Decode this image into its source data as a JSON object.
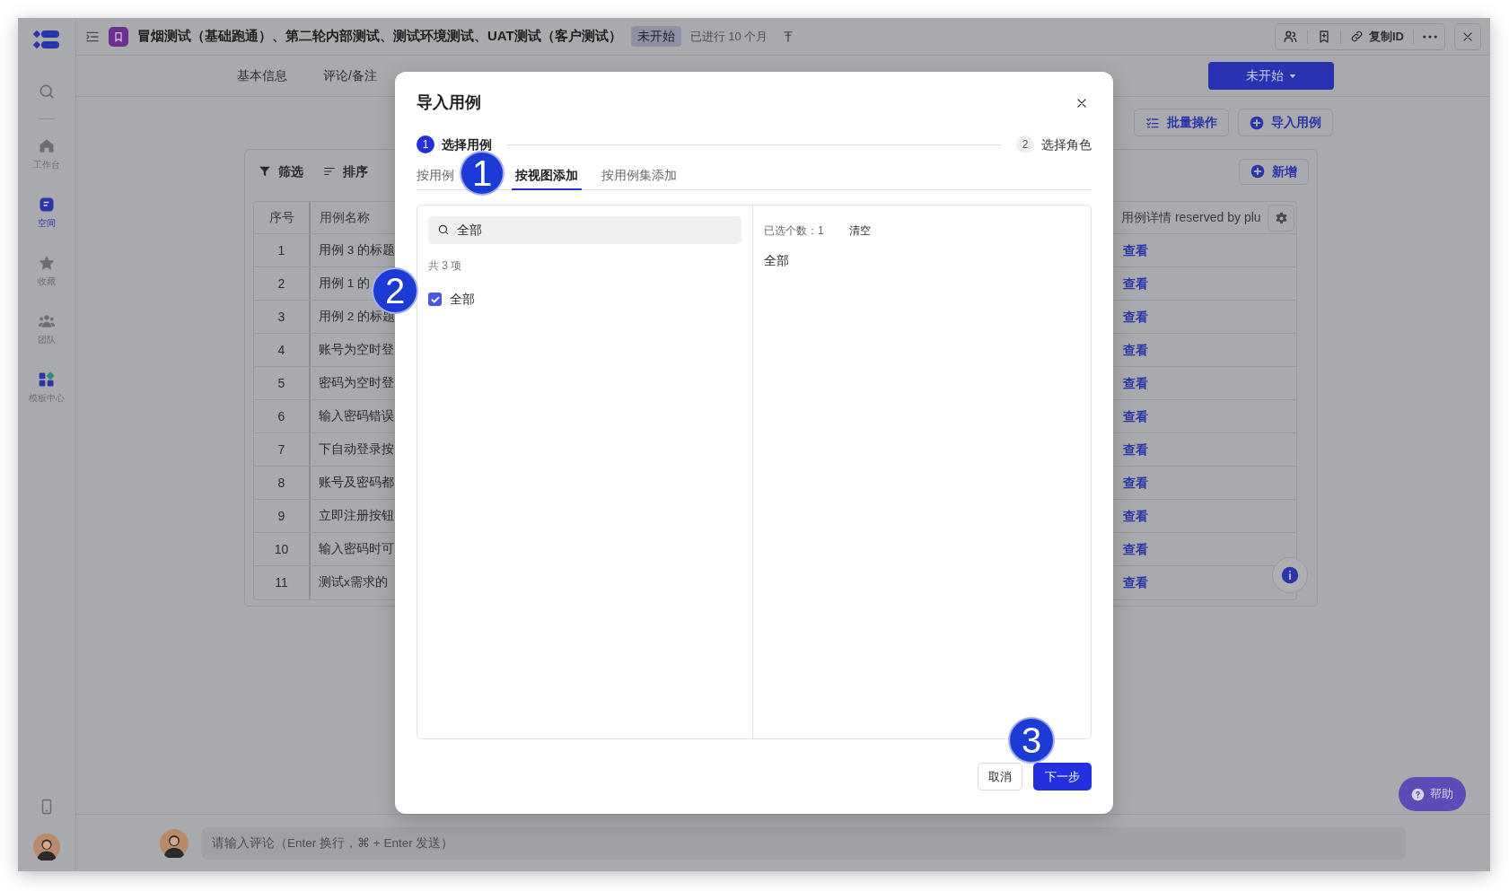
{
  "sidebar": {
    "items": [
      {
        "label": "工作台",
        "selected": false
      },
      {
        "label": "空间",
        "selected": true
      },
      {
        "label": "收藏",
        "selected": false
      },
      {
        "label": "团队",
        "selected": false
      },
      {
        "label": "模板中心",
        "selected": false
      }
    ]
  },
  "header": {
    "title": "冒烟测试（基础跑通）、第二轮内部测试、测试环境测试、UAT测试（客户测试）",
    "status_tag": "未开始",
    "elapsed": "已进行 10 个月",
    "copy_id": "复制ID"
  },
  "page_tabs": [
    "基本信息",
    "评论/备注"
  ],
  "status_button": "未开始",
  "toolbar": [
    "批量操作",
    "导入用例"
  ],
  "table": {
    "filter": "筛选",
    "sort": "排序",
    "add": "新增",
    "columns": [
      "序号",
      "用例名称",
      "用例详情 reserved by plu"
    ],
    "rows": [
      {
        "index": "1",
        "name": "用例 3 的标题",
        "detail": "查看"
      },
      {
        "index": "2",
        "name": "用例 1 的",
        "detail": "查看"
      },
      {
        "index": "3",
        "name": "用例 2 的标题",
        "detail": "查看"
      },
      {
        "index": "4",
        "name": "账号为空时登",
        "detail": "查看"
      },
      {
        "index": "5",
        "name": "密码为空时登",
        "detail": "查看"
      },
      {
        "index": "6",
        "name": "输入密码错误",
        "detail": "查看"
      },
      {
        "index": "7",
        "name": "下自动登录按",
        "detail": "查看"
      },
      {
        "index": "8",
        "name": "账号及密码都",
        "detail": "查看"
      },
      {
        "index": "9",
        "name": "立即注册按钮",
        "detail": "查看"
      },
      {
        "index": "10",
        "name": "输入密码时可",
        "detail": "查看"
      },
      {
        "index": "11",
        "name": "测试x需求的",
        "detail": "查看"
      }
    ]
  },
  "modal": {
    "title": "导入用例",
    "steps": [
      {
        "number": "1",
        "label": "选择用例",
        "selected": true
      },
      {
        "number": "2",
        "label": "选择角色",
        "selected": false
      }
    ],
    "tabs": [
      {
        "label": "按用例",
        "selected": false
      },
      {
        "label": "按视图添加",
        "selected": true
      },
      {
        "label": "按用例集添加",
        "selected": false
      }
    ],
    "search": {
      "value": "全部"
    },
    "total": "共 3 项",
    "options": [
      {
        "label": "全部",
        "checked": true
      }
    ],
    "selected_count": "已选个数：1",
    "clear": "清空",
    "selected_items": [
      "全部"
    ],
    "cancel": "取消",
    "next": "下一步"
  },
  "annotations": [
    "1",
    "2",
    "3"
  ],
  "comment": {
    "placeholder": "请输入评论（Enter 换行，⌘ + Enter 发送）"
  },
  "help": "帮助"
}
